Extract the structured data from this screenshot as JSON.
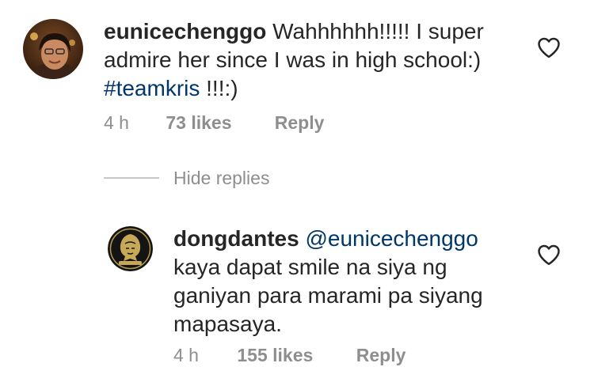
{
  "comment": {
    "username": "eunicechenggo",
    "text": "Wahhhhhh!!!!! I super admire her since I was in high school:)",
    "hashtag": "#teamkris",
    "suffix": "!!!:)",
    "time": "4 h",
    "likes": "73 likes",
    "reply_label": "Reply"
  },
  "thread": {
    "hide_replies_label": "Hide replies"
  },
  "reply": {
    "username": "dongdantes",
    "mention": "@eunicechenggo",
    "text": "kaya dapat smile na siya ng ganiyan para marami pa siyang mapasaya.",
    "time": "4 h",
    "likes": "155 likes",
    "reply_label": "Reply"
  },
  "icons": {
    "like": "heart-outline-icon"
  },
  "colors": {
    "text": "#262626",
    "secondary": "#8e8e8e",
    "link": "#00376b",
    "divider": "#c7c7c7"
  }
}
